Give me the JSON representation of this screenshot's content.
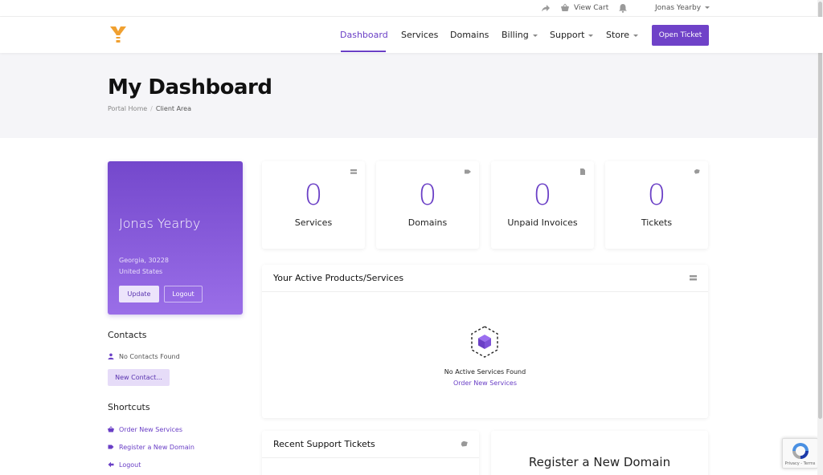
{
  "topbar": {
    "view_cart": "View Cart",
    "user_name": "Jonas Yearby"
  },
  "nav": {
    "items": [
      {
        "label": "Dashboard",
        "active": true,
        "dropdown": false
      },
      {
        "label": "Services",
        "active": false,
        "dropdown": false
      },
      {
        "label": "Domains",
        "active": false,
        "dropdown": false
      },
      {
        "label": "Billing",
        "active": false,
        "dropdown": true
      },
      {
        "label": "Support",
        "active": false,
        "dropdown": true
      },
      {
        "label": "Store",
        "active": false,
        "dropdown": true
      }
    ],
    "open_ticket": "Open Ticket"
  },
  "hero": {
    "title": "My Dashboard",
    "breadcrumb_home": "Portal Home",
    "breadcrumb_separator": "/",
    "breadcrumb_current": "Client Area"
  },
  "profile": {
    "name": "Jonas Yearby",
    "address_line1": "Georgia, 30228",
    "address_line2": "United States",
    "update_label": "Update",
    "logout_label": "Logout"
  },
  "contacts": {
    "title": "Contacts",
    "empty": "No Contacts Found",
    "new_contact": "New Contact..."
  },
  "shortcuts": {
    "title": "Shortcuts",
    "items": [
      {
        "label": "Order New Services",
        "icon": "basket-icon"
      },
      {
        "label": "Register a New Domain",
        "icon": "tag-icon"
      },
      {
        "label": "Logout",
        "icon": "arrow-left-icon"
      }
    ]
  },
  "stats": [
    {
      "value": "0",
      "label": "Services",
      "icon": "server-icon"
    },
    {
      "value": "0",
      "label": "Domains",
      "icon": "tag-icon"
    },
    {
      "value": "0",
      "label": "Unpaid Invoices",
      "icon": "document-icon"
    },
    {
      "value": "0",
      "label": "Tickets",
      "icon": "comment-icon"
    }
  ],
  "products_panel": {
    "title": "Your Active Products/Services",
    "empty": "No Active Services Found",
    "order_link": "Order New Services"
  },
  "tickets_panel": {
    "title": "Recent Support Tickets"
  },
  "register_panel": {
    "title": "Register a New Domain"
  },
  "recaptcha": {
    "text": "Privacy - Terms"
  },
  "colors": {
    "accent": "#6a3fc6",
    "card_gradient_top": "#7448cc",
    "card_gradient_bottom": "#9a6ee8"
  }
}
